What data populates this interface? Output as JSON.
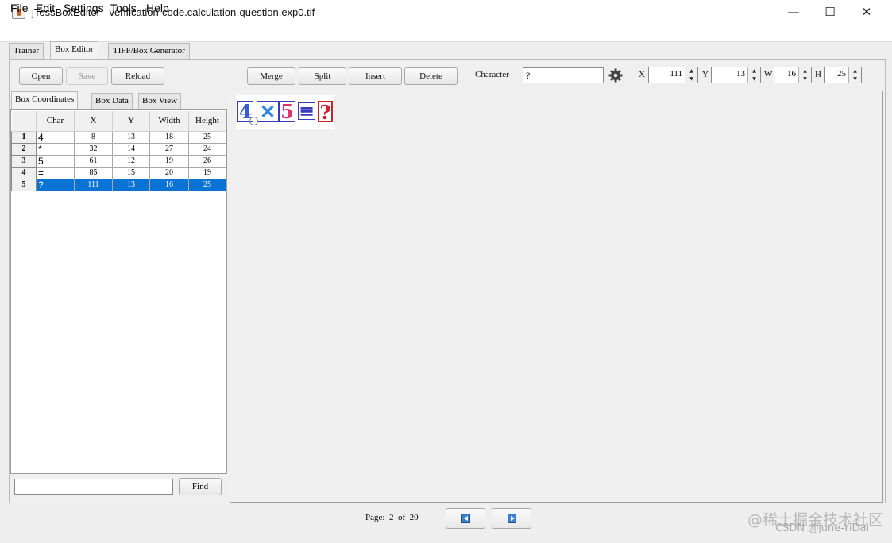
{
  "window": {
    "title": "jTessBoxEditor - verification-code.calculation-question.exp0.tif",
    "minimize": "—",
    "maximize": "☐",
    "close": "✕"
  },
  "menu": {
    "items": [
      {
        "label": "File"
      },
      {
        "label": "Edit"
      },
      {
        "label": "Settings"
      },
      {
        "label": "Tools"
      },
      {
        "label": "Help"
      }
    ]
  },
  "main_tabs": [
    {
      "label": "Trainer"
    },
    {
      "label": "Box Editor",
      "active": true
    },
    {
      "label": "TIFF/Box Generator"
    }
  ],
  "toolbar": {
    "open": "Open",
    "save": "Save",
    "reload": "Reload",
    "merge": "Merge",
    "split": "Split",
    "insert": "Insert",
    "delete": "Delete",
    "character_label": "Character",
    "character_value": "?",
    "x_label": "X",
    "x_value": "111",
    "y_label": "Y",
    "y_value": "13",
    "w_label": "W",
    "w_value": "16",
    "h_label": "H",
    "h_value": "25"
  },
  "left_tabs": [
    {
      "label": "Box Coordinates",
      "active": true
    },
    {
      "label": "Box Data"
    },
    {
      "label": "Box View"
    }
  ],
  "table": {
    "headers": [
      "",
      "Char",
      "X",
      "Y",
      "Width",
      "Height"
    ],
    "rows": [
      {
        "num": "1",
        "char": "4",
        "x": "8",
        "y": "13",
        "w": "18",
        "h": "25"
      },
      {
        "num": "2",
        "char": "*",
        "x": "32",
        "y": "14",
        "w": "27",
        "h": "24"
      },
      {
        "num": "3",
        "char": "5",
        "x": "61",
        "y": "12",
        "w": "19",
        "h": "26"
      },
      {
        "num": "4",
        "char": "=",
        "x": "85",
        "y": "15",
        "w": "20",
        "h": "19"
      },
      {
        "num": "5",
        "char": "?",
        "x": "111",
        "y": "13",
        "w": "16",
        "h": "25",
        "selected": true
      }
    ]
  },
  "find": {
    "value": "",
    "button": "Find"
  },
  "captcha": {
    "glyphs": [
      "4",
      "✕",
      "5",
      "≡",
      "?"
    ],
    "colors": [
      "#3b5ad6",
      "#2f86e6",
      "#e0306a",
      "#3a3ab8",
      "#d0202a"
    ]
  },
  "status": {
    "page_label": "Page:",
    "page_current": "2",
    "page_of": "of",
    "page_total": "20"
  },
  "watermark": {
    "line1": "@稀土掘金技术社区",
    "line2": "CSDN @june-YiDai"
  },
  "accent_color": "#0a73d3"
}
